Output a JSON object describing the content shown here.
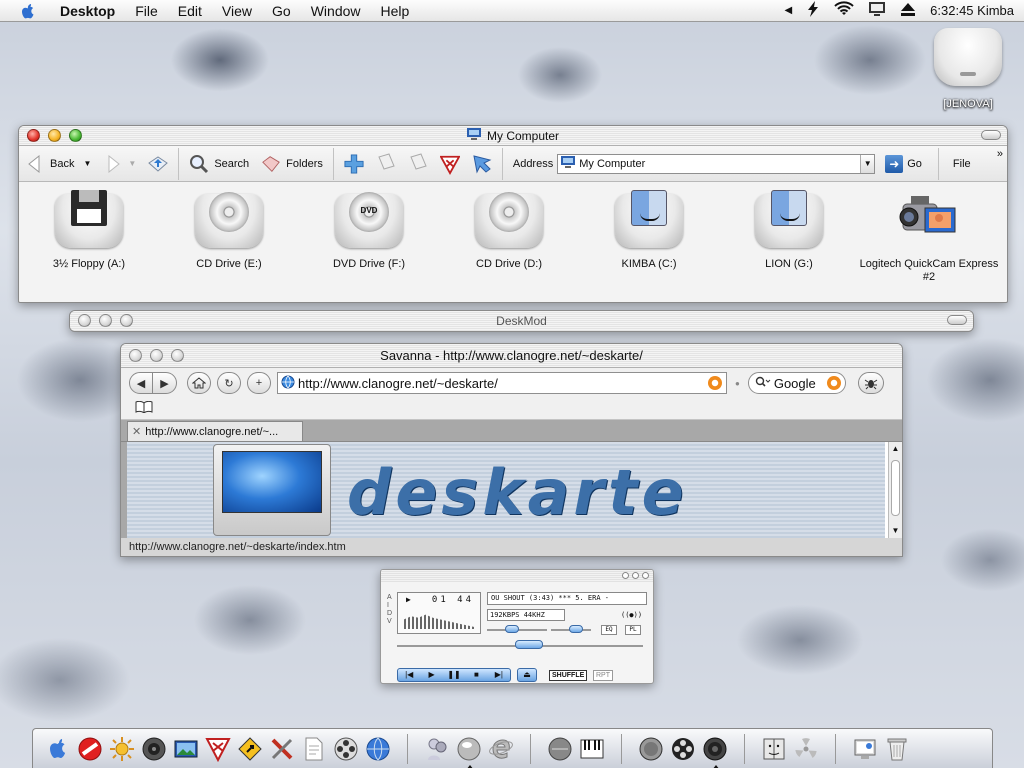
{
  "menubar": {
    "app_name": "Desktop",
    "items": [
      "File",
      "Edit",
      "View",
      "Go",
      "Window",
      "Help"
    ],
    "clock": "6:32:45 Kimba"
  },
  "desktop": {
    "hd_label": "[JENOVA]"
  },
  "my_computer": {
    "title": "My Computer",
    "toolbar": {
      "back": "Back",
      "search": "Search",
      "folders": "Folders",
      "address_label": "Address",
      "address_value": "My Computer",
      "go": "Go",
      "file": "File",
      "more": "»"
    },
    "drives": [
      {
        "label": "3½ Floppy (A:)",
        "kind": "floppy"
      },
      {
        "label": "CD Drive (E:)",
        "kind": "cd"
      },
      {
        "label": "DVD Drive (F:)",
        "kind": "dvd",
        "badge": "DVD"
      },
      {
        "label": "CD Drive (D:)",
        "kind": "cd"
      },
      {
        "label": "KIMBA (C:)",
        "kind": "finder"
      },
      {
        "label": "LION (G:)",
        "kind": "finder"
      },
      {
        "label": "Logitech QuickCam Express #2",
        "kind": "camera"
      }
    ]
  },
  "deskmod": {
    "title": "DeskMod"
  },
  "savanna": {
    "title": "Savanna - http://www.clanogre.net/~deskarte/",
    "url": "http://www.clanogre.net/~deskarte/",
    "search_engine": "Google",
    "tab_label": "http://www.clanogre.net/~...",
    "banner_text": "deskarte",
    "status": "http://www.clanogre.net/~deskarte/index.htm"
  },
  "player": {
    "time": "01 44",
    "side_letters": [
      "A",
      "I",
      "D",
      "V"
    ],
    "song": "OU SHOUT (3:43)  ***  5. ERA - ",
    "rate": "192KBPS 44KHZ",
    "stereo": "((●))",
    "eq": "EQ",
    "pl": "PL",
    "transport": [
      "|◀",
      "▶",
      "❚❚",
      "■",
      "▶|"
    ],
    "eject": "⏏",
    "shuffle": "SHUFFLE",
    "repeat": "RPT"
  },
  "dock": {
    "groups": [
      [
        "finder-icon",
        "stop-icon",
        "sun-icon",
        "speaker-icon",
        "picture-icon",
        "vivaldi-icon",
        "warning-icon",
        "tools-icon",
        "document-icon",
        "film-reel-icon",
        "globe-icon"
      ],
      [
        "people-icon",
        "orb-icon",
        "ie-icon"
      ],
      [
        "dial-icon",
        "keyboard-icon"
      ],
      [
        "disk-icon",
        "reel-icon",
        "speaker-cone-icon"
      ],
      [
        "mac-face-icon",
        "radiation-icon"
      ],
      [
        "monitor-icon",
        "trash-icon"
      ]
    ]
  }
}
